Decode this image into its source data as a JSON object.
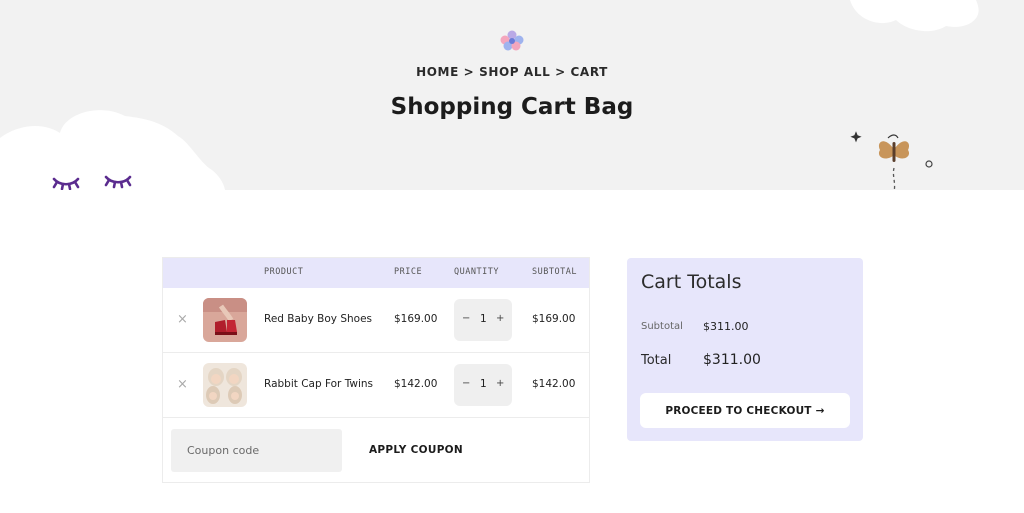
{
  "header": {
    "breadcrumb": "HOME > SHOP ALL > CART",
    "title": "Shopping Cart Bag"
  },
  "cart": {
    "columns": [
      "PRODUCT",
      "PRICE",
      "QUANTITY",
      "SUBTOTAL"
    ],
    "items": [
      {
        "remove": "×",
        "name": "Red Baby Boy Shoes",
        "price": "$169.00",
        "quantity": "1",
        "subtotal": "$169.00",
        "minus": "−",
        "plus": "+",
        "thumb_icon": "red-shoes-image"
      },
      {
        "remove": "×",
        "name": "Rabbit Cap For Twins",
        "price": "$142.00",
        "quantity": "1",
        "subtotal": "$142.00",
        "minus": "−",
        "plus": "+",
        "thumb_icon": "rabbit-cap-image"
      }
    ],
    "coupon": {
      "placeholder": "Coupon code",
      "value": "",
      "apply_label": "APPLY COUPON"
    }
  },
  "totals": {
    "title": "Cart Totals",
    "subtotal_label": "Subtotal",
    "subtotal_value": "$311.00",
    "total_label": "Total",
    "total_value": "$311.00",
    "checkout_label": "PROCEED TO CHECKOUT",
    "checkout_arrow": "→"
  },
  "colors": {
    "hero_bg": "#f2f2f2",
    "lavender": "#e7e6fb",
    "eyelash_purple": "#5b2c8f",
    "butterfly_tan": "#c8955a"
  }
}
